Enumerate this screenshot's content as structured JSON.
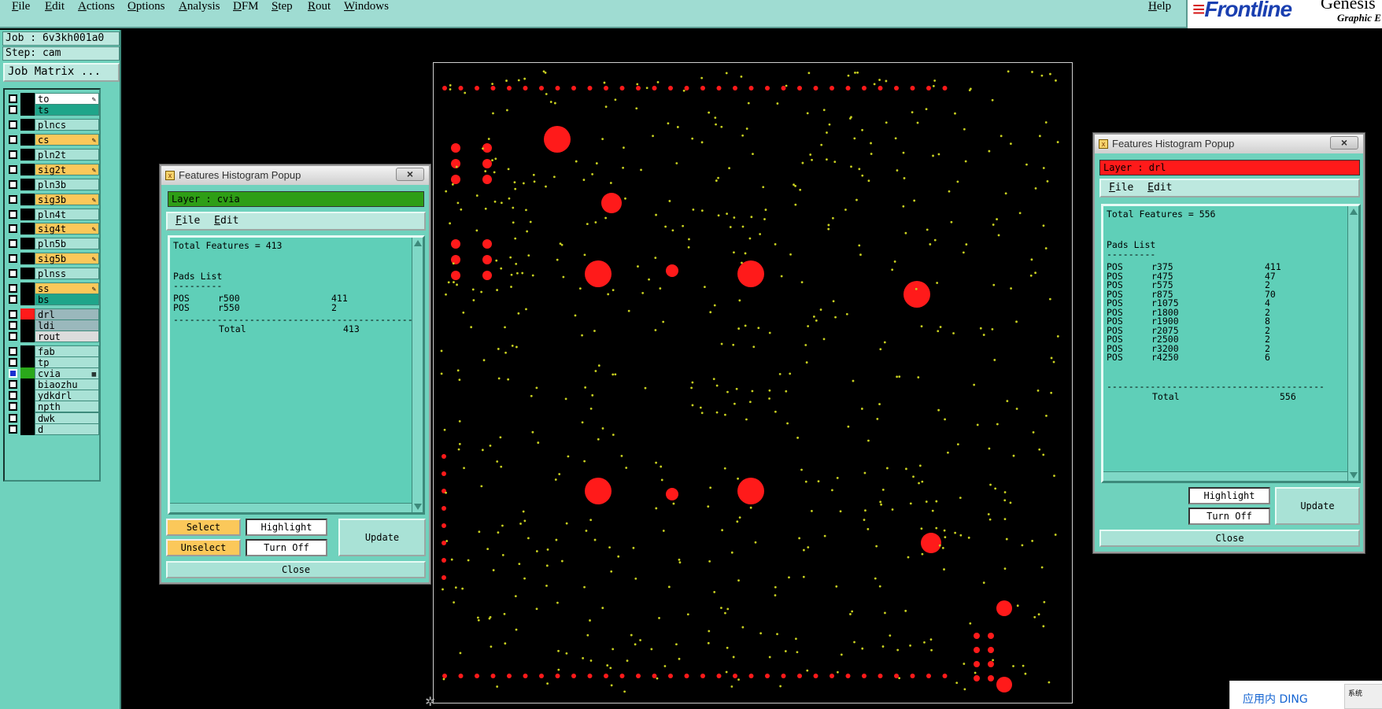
{
  "menubar": {
    "items": [
      "File",
      "Edit",
      "Actions",
      "Options",
      "Analysis",
      "DFM",
      "Step",
      "Rout",
      "Windows"
    ],
    "help": "Help"
  },
  "brand": {
    "logo": "Frontline",
    "product": "Genesis",
    "subtitle": "Graphic E"
  },
  "left_panel": {
    "job": "Job : 6v3kh001a0",
    "step": "Step: cam",
    "job_matrix": "Job Matrix ...",
    "layers": [
      {
        "name": "to",
        "bg": "#ffffff",
        "mark": "pen",
        "swatch": "#000000"
      },
      {
        "name": "ts",
        "bg": "#1fa58a",
        "mark": "",
        "swatch": "#000000"
      },
      {
        "name": "plncs",
        "bg": "#a9e2d6",
        "mark": "",
        "swatch": "#000000"
      },
      {
        "name": "cs",
        "bg": "#fbc85a",
        "mark": "pen",
        "swatch": "#000000"
      },
      {
        "name": "pln2t",
        "bg": "#a9e2d6",
        "mark": "",
        "swatch": "#000000"
      },
      {
        "name": "sig2t",
        "bg": "#fbc85a",
        "mark": "pen",
        "swatch": "#000000"
      },
      {
        "name": "pln3b",
        "bg": "#a9e2d6",
        "mark": "",
        "swatch": "#000000"
      },
      {
        "name": "sig3b",
        "bg": "#fbc85a",
        "mark": "pen",
        "swatch": "#000000"
      },
      {
        "name": "pln4t",
        "bg": "#a9e2d6",
        "mark": "",
        "swatch": "#000000"
      },
      {
        "name": "sig4t",
        "bg": "#fbc85a",
        "mark": "pen",
        "swatch": "#000000"
      },
      {
        "name": "pln5b",
        "bg": "#a9e2d6",
        "mark": "",
        "swatch": "#000000"
      },
      {
        "name": "sig5b",
        "bg": "#fbc85a",
        "mark": "pen",
        "swatch": "#000000"
      },
      {
        "name": "plnss",
        "bg": "#a9e2d6",
        "mark": "",
        "swatch": "#000000"
      },
      {
        "name": "ss",
        "bg": "#fbc85a",
        "mark": "pen",
        "swatch": "#000000"
      },
      {
        "name": "bs",
        "bg": "#1fa58a",
        "mark": "",
        "swatch": "#000000"
      },
      {
        "name": "drl",
        "bg": "#9ab8bc",
        "mark": "",
        "swatch": "#ff1a1a"
      },
      {
        "name": "ldi",
        "bg": "#9ab8bc",
        "mark": "",
        "swatch": "#000000"
      },
      {
        "name": "rout",
        "bg": "#dcdcdc",
        "mark": "",
        "swatch": "#000000"
      },
      {
        "name": "fab",
        "bg": "#a9e2d6",
        "mark": "",
        "swatch": "#000000"
      },
      {
        "name": "tp",
        "bg": "#a9e2d6",
        "mark": "",
        "swatch": "#000000"
      },
      {
        "name": "cvia",
        "bg": "#a9e2d6",
        "mark": "grid",
        "swatch": "#2aa81a"
      },
      {
        "name": "biaozhu",
        "bg": "#a9e2d6",
        "mark": "",
        "swatch": "#000000"
      },
      {
        "name": "ydkdrl",
        "bg": "#a9e2d6",
        "mark": "",
        "swatch": "#000000"
      },
      {
        "name": "npth",
        "bg": "#a9e2d6",
        "mark": "",
        "swatch": "#000000"
      },
      {
        "name": "dwk",
        "bg": "#a9e2d6",
        "mark": "",
        "swatch": "#000000"
      },
      {
        "name": "d",
        "bg": "#a9e2d6",
        "mark": "",
        "swatch": "#000000"
      }
    ]
  },
  "popup_cvia": {
    "title": "Features Histogram Popup",
    "layer_label": "Layer :  cvia",
    "layer_color": "#2e9e16",
    "menu": [
      "File",
      "Edit"
    ],
    "report": {
      "total_line": "Total Features = 413",
      "section": "Pads List",
      "rule": "---------",
      "rows": [
        {
          "type": "POS",
          "sym": "r500",
          "count": "411"
        },
        {
          "type": "POS",
          "sym": "r550",
          "count": "2"
        }
      ],
      "divider": "--------------------------------------------",
      "total_label": "Total",
      "total": "413"
    },
    "buttons": {
      "select": "Select",
      "unselect": "Unselect",
      "highlight": "Highlight",
      "turn_off": "Turn Off",
      "update": "Update",
      "close": "Close"
    }
  },
  "popup_drl": {
    "title": "Features Histogram Popup",
    "layer_label": "Layer :  drl",
    "layer_color": "#ff1a1a",
    "menu": [
      "File",
      "Edit"
    ],
    "report": {
      "total_line": "Total Features = 556",
      "section": "Pads List",
      "rule": "---------",
      "rows": [
        {
          "type": "POS",
          "sym": "r375",
          "count": "411"
        },
        {
          "type": "POS",
          "sym": "r475",
          "count": "47"
        },
        {
          "type": "POS",
          "sym": "r575",
          "count": "2"
        },
        {
          "type": "POS",
          "sym": "r875",
          "count": "70"
        },
        {
          "type": "POS",
          "sym": "r1075",
          "count": "4"
        },
        {
          "type": "POS",
          "sym": "r1800",
          "count": "2"
        },
        {
          "type": "POS",
          "sym": "r1900",
          "count": "8"
        },
        {
          "type": "POS",
          "sym": "r2075",
          "count": "2"
        },
        {
          "type": "POS",
          "sym": "r2500",
          "count": "2"
        },
        {
          "type": "POS",
          "sym": "r3200",
          "count": "2"
        },
        {
          "type": "POS",
          "sym": "r4250",
          "count": "6"
        }
      ],
      "divider": "----------------------------------------",
      "total_label": "Total",
      "total": "556"
    },
    "buttons": {
      "highlight": "Highlight",
      "turn_off": "Turn Off",
      "update": "Update",
      "close": "Close"
    }
  },
  "tray": {
    "ding": "应用内 DING",
    "sys": "系统"
  },
  "colors": {
    "drill_pad": "#ff1a1a",
    "via_pad": "#c8d020",
    "panel": "#6fd2bd"
  }
}
